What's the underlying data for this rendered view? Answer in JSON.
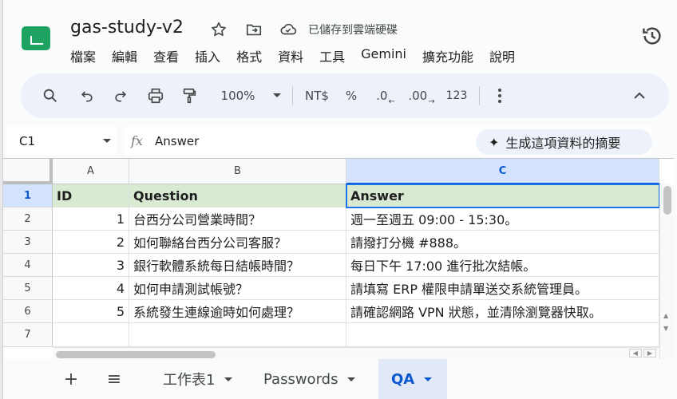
{
  "app": {
    "doc_title": "gas-study-v2",
    "save_status": "已儲存到雲端硬碟"
  },
  "menu": [
    "檔案",
    "編輯",
    "查看",
    "插入",
    "格式",
    "資料",
    "工具",
    "Gemini",
    "擴充功能",
    "說明"
  ],
  "toolbar": {
    "zoom": "100%",
    "currency": "NT$",
    "percent": "%",
    "decrease_decimal": ".0",
    "increase_decimal": ".00",
    "number_format": "123"
  },
  "formula_bar": {
    "cell_ref": "C1",
    "fx": "fx",
    "content": "Answer",
    "ai_summary": "生成這項資料的摘要"
  },
  "grid": {
    "columns": [
      "A",
      "B",
      "C"
    ],
    "rows": [
      "1",
      "2",
      "3",
      "4",
      "5",
      "6",
      "7"
    ],
    "cells": [
      [
        "ID",
        "Question",
        "Answer"
      ],
      [
        "1",
        "台西分公司營業時間？",
        "週一至週五 09:00 - 15:30。"
      ],
      [
        "2",
        "如何聯絡台西分公司客服？",
        "請撥打分機 #888。"
      ],
      [
        "3",
        "銀行軟體系統每日結帳時間？",
        "每日下午 17:00 進行批次結帳。"
      ],
      [
        "4",
        "如何申請測試帳號？",
        "請填寫 ERP 權限申請單送交系統管理員。"
      ],
      [
        "5",
        "系統發生連線逾時如何處理？",
        "請確認網路 VPN 狀態，並清除瀏覽器快取。"
      ],
      [
        "",
        "",
        ""
      ]
    ],
    "selected_cell": "C1",
    "header_row_color": "#d9ead3",
    "selection_color": "#1a73e8"
  },
  "sheet_tabs": {
    "add": "+",
    "list": "≡",
    "tabs": [
      "工作表1",
      "Passwords",
      "QA"
    ],
    "active": "QA"
  }
}
